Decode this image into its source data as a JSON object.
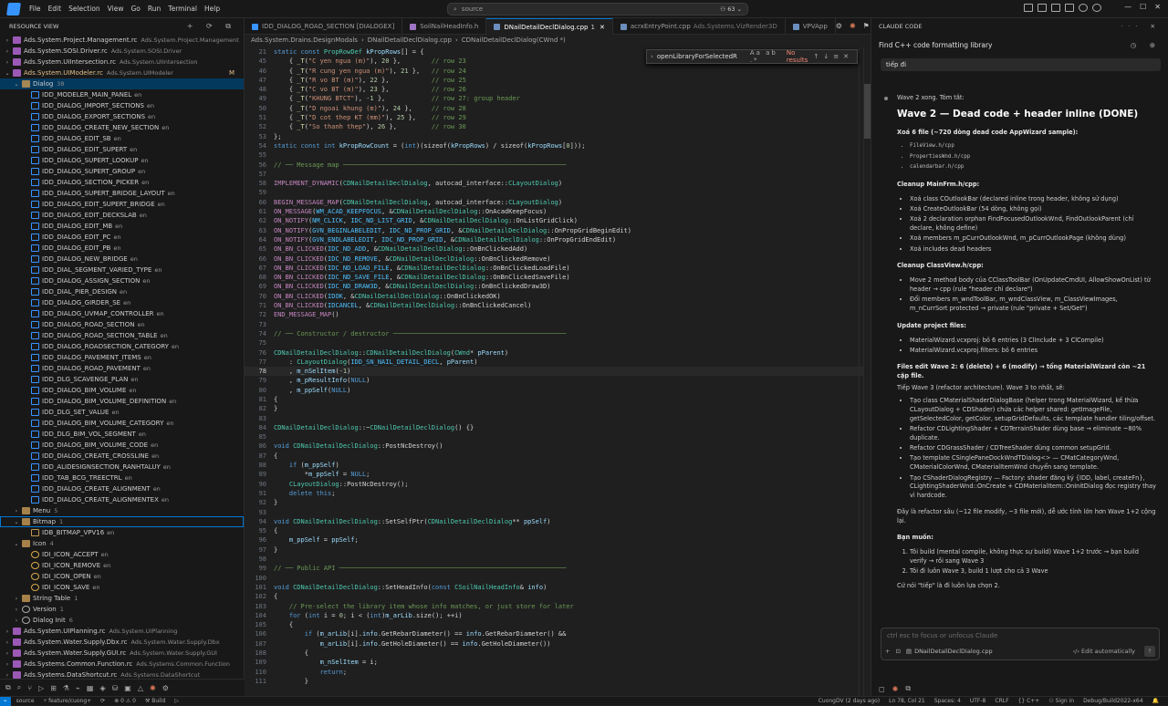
{
  "titlebar": {
    "menu": [
      "File",
      "Edit",
      "Selection",
      "View",
      "Go",
      "Run",
      "Terminal",
      "Help"
    ],
    "search": "source",
    "badge": "63"
  },
  "sidebar": {
    "title": "RESOURCE VIEW",
    "rows": [
      {
        "d": 0,
        "tw": "›",
        "ic": "rc",
        "label": "Ads.System.Project.Management.rc",
        "sub": "Ads.System.Project.Management"
      },
      {
        "d": 0,
        "tw": "›",
        "ic": "rc",
        "label": "Ads.System.SOSI.Driver.rc",
        "sub": "Ads.System.SOSI.Driver"
      },
      {
        "d": 0,
        "tw": "›",
        "ic": "rc",
        "label": "Ads.System.UIIntersection.rc",
        "sub": "Ads.System.UIIntersection"
      },
      {
        "d": 0,
        "tw": "⌄",
        "ic": "rc",
        "label": "Ads.System.UIModeler.rc",
        "sub": "Ads.System.UIModeler",
        "m": "M",
        "mod": true
      },
      {
        "d": 1,
        "tw": "⌄",
        "ic": "folder",
        "label": "Dialog",
        "sub": "38",
        "sel": true
      },
      {
        "d": 2,
        "ic": "dialog",
        "label": "IDD_MODELER_MAIN_PANEL",
        "en": "en"
      },
      {
        "d": 2,
        "ic": "dialog",
        "label": "IDD_DIALOG_IMPORT_SECTIONS",
        "en": "en"
      },
      {
        "d": 2,
        "ic": "dialog",
        "label": "IDD_DIALOG_EXPORT_SECTIONS",
        "en": "en"
      },
      {
        "d": 2,
        "ic": "dialog",
        "label": "IDD_DIALOG_CREATE_NEW_SECTION",
        "en": "en"
      },
      {
        "d": 2,
        "ic": "dialog",
        "label": "IDD_DIALOG_EDIT_SB",
        "en": "en"
      },
      {
        "d": 2,
        "ic": "dialog",
        "label": "IDD_DIALOG_EDIT_SUPERT",
        "en": "en"
      },
      {
        "d": 2,
        "ic": "dialog",
        "label": "IDD_DIALOG_SUPERT_LOOKUP",
        "en": "en"
      },
      {
        "d": 2,
        "ic": "dialog",
        "label": "IDD_DIALOG_SUPERT_GROUP",
        "en": "en"
      },
      {
        "d": 2,
        "ic": "dialog",
        "label": "IDD_DIALOG_SECTION_PICKER",
        "en": "en"
      },
      {
        "d": 2,
        "ic": "dialog",
        "label": "IDD_DIALOG_SUPERT_BRIDGE_LAYOUT",
        "en": "en"
      },
      {
        "d": 2,
        "ic": "dialog",
        "label": "IDD_DIALOG_EDIT_SUPERT_BRIDGE",
        "en": "en"
      },
      {
        "d": 2,
        "ic": "dialog",
        "label": "IDD_DIALOG_EDIT_DECKSLAB",
        "en": "en"
      },
      {
        "d": 2,
        "ic": "dialog",
        "label": "IDD_DIALOG_EDIT_MB",
        "en": "en"
      },
      {
        "d": 2,
        "ic": "dialog",
        "label": "IDD_DIALOG_EDIT_PC",
        "en": "en"
      },
      {
        "d": 2,
        "ic": "dialog",
        "label": "IDD_DIALOG_EDIT_PB",
        "en": "en"
      },
      {
        "d": 2,
        "ic": "dialog",
        "label": "IDD_DIALOG_NEW_BRIDGE",
        "en": "en"
      },
      {
        "d": 2,
        "ic": "dialog",
        "label": "IDD_DIAL_SEGMENT_VARIED_TYPE",
        "en": "en"
      },
      {
        "d": 2,
        "ic": "dialog",
        "label": "IDD_DIALOG_ASSIGN_SECTION",
        "en": "en"
      },
      {
        "d": 2,
        "ic": "dialog",
        "label": "IDD_DIAL_PIER_DESIGN",
        "en": "en"
      },
      {
        "d": 2,
        "ic": "dialog",
        "label": "IDD_DIALOG_GIRDER_SE",
        "en": "en"
      },
      {
        "d": 2,
        "ic": "dialog",
        "label": "IDD_DIALOG_UVMAP_CONTROLLER",
        "en": "en"
      },
      {
        "d": 2,
        "ic": "dialog",
        "label": "IDD_DIALOG_ROAD_SECTION",
        "en": "en"
      },
      {
        "d": 2,
        "ic": "dialog",
        "label": "IDD_DIALOG_ROAD_SECTION_TABLE",
        "en": "en"
      },
      {
        "d": 2,
        "ic": "dialog",
        "label": "IDD_DIALOG_ROADSECTION_CATEGORY",
        "en": "en"
      },
      {
        "d": 2,
        "ic": "dialog",
        "label": "IDD_DIALOG_PAVEMENT_ITEMS",
        "en": "en"
      },
      {
        "d": 2,
        "ic": "dialog",
        "label": "IDD_DIALOG_ROAD_PAVEMENT",
        "en": "en"
      },
      {
        "d": 2,
        "ic": "dialog",
        "label": "IDD_DLG_SCAVENGE_PLAN",
        "en": "en"
      },
      {
        "d": 2,
        "ic": "dialog",
        "label": "IDD_DIALOG_BIM_VOLUME",
        "en": "en"
      },
      {
        "d": 2,
        "ic": "dialog",
        "label": "IDD_DIALOG_BIM_VOLUME_DEFINITION",
        "en": "en"
      },
      {
        "d": 2,
        "ic": "dialog",
        "label": "IDD_DLG_SET_VALUE",
        "en": "en"
      },
      {
        "d": 2,
        "ic": "dialog",
        "label": "IDD_DIALOG_BIM_VOLUME_CATEGORY",
        "en": "en"
      },
      {
        "d": 2,
        "ic": "dialog",
        "label": "IDD_DLG_BIM_VOL_SEGMENT",
        "en": "en"
      },
      {
        "d": 2,
        "ic": "dialog",
        "label": "IDD_DIALOG_BIM_VOLUME_CODE",
        "en": "en"
      },
      {
        "d": 2,
        "ic": "dialog",
        "label": "IDD_DIALOG_CREATE_CROSSLINE",
        "en": "en"
      },
      {
        "d": 2,
        "ic": "dialog",
        "label": "IDD_ALIDESIGNSECTION_RANHTALUY",
        "en": "en"
      },
      {
        "d": 2,
        "ic": "dialog",
        "label": "IDD_TAB_BCG_TREECTRL",
        "en": "en"
      },
      {
        "d": 2,
        "ic": "dialog",
        "label": "IDD_DIALOG_CREATE_ALIGNMENT",
        "en": "en"
      },
      {
        "d": 2,
        "ic": "dialog",
        "label": "IDD_DIALOG_CREATE_ALIGNMENTEX",
        "en": "en"
      },
      {
        "d": 1,
        "tw": "›",
        "ic": "folder",
        "label": "Menu",
        "sub": "5"
      },
      {
        "d": 1,
        "tw": "⌄",
        "ic": "folder",
        "label": "Bitmap",
        "sub": "1",
        "hl": true
      },
      {
        "d": 2,
        "ic": "bitmap",
        "label": "IDB_BITMAP_VPV16",
        "en": "en"
      },
      {
        "d": 1,
        "tw": "⌄",
        "ic": "folder",
        "label": "Icon",
        "sub": "4"
      },
      {
        "d": 2,
        "ic": "icon",
        "label": "IDI_ICON_ACCEPT",
        "en": "en"
      },
      {
        "d": 2,
        "ic": "icon",
        "label": "IDI_ICON_REMOVE",
        "en": "en"
      },
      {
        "d": 2,
        "ic": "icon",
        "label": "IDI_ICON_OPEN",
        "en": "en"
      },
      {
        "d": 2,
        "ic": "icon",
        "label": "IDI_ICON_SAVE",
        "en": "en"
      },
      {
        "d": 1,
        "tw": "›",
        "ic": "folder",
        "label": "String Table",
        "sub": "1"
      },
      {
        "d": 1,
        "tw": "›",
        "ic": "gear",
        "label": "Version",
        "sub": "1"
      },
      {
        "d": 1,
        "tw": "›",
        "ic": "gear",
        "label": "Dialog Init",
        "sub": "6"
      },
      {
        "d": 0,
        "tw": "›",
        "ic": "rc",
        "label": "Ads.System.UIPlanning.rc",
        "sub": "Ads.System.UIPlanning"
      },
      {
        "d": 0,
        "tw": "›",
        "ic": "rc",
        "label": "Ads.System.Water.Supply.Dbx.rc",
        "sub": "Ads.System.Water.Supply.Dbx"
      },
      {
        "d": 0,
        "tw": "›",
        "ic": "rc",
        "label": "Ads.System.Water.Supply.GUI.rc",
        "sub": "Ads.System.Water.Supply.GUI"
      },
      {
        "d": 0,
        "tw": "›",
        "ic": "rc",
        "label": "Ads.Systems.Common.Function.rc",
        "sub": "Ads.Systems.Common.Function"
      },
      {
        "d": 0,
        "tw": "›",
        "ic": "rc",
        "label": "Ads.Systems.DataShortcut.rc",
        "sub": "Ads.Systems.DataShortcut"
      }
    ]
  },
  "tabs": [
    {
      "label": "IDD_DIALOG_ROAD_SECTION [DIALOGEX]",
      "ic": "#3794ff",
      "desc": ""
    },
    {
      "label": "SoilNailHeadInfo.h",
      "ic": "#a074c4",
      "desc": ""
    },
    {
      "label": "DNailDetailDeclDialog.cpp",
      "ic": "#6c8ebf",
      "desc": "1",
      "active": true
    },
    {
      "label": "acrxEntryPoint.cpp",
      "ic": "#6c8ebf",
      "desc": "Ads.Systems.VizRender3D"
    },
    {
      "label": "VPVApp",
      "ic": "#6c8ebf",
      "desc": ""
    }
  ],
  "breadcrumb": [
    "Ads.System.Drains.DesignModals",
    "DNailDetailDeclDialog.cpp",
    "CDNailDetailDeclDialog(CWnd *)"
  ],
  "find": {
    "query": "openLibraryForSelectedR",
    "opts": "Aa ab .*",
    "result": "No results"
  },
  "code": [
    {
      "n": "21",
      "t": "static const PropRowDef kPropRows[] = {"
    },
    {
      "n": "45",
      "t": "    { _T(\"C yen ngua (m)\"), 20 },        // row 23"
    },
    {
      "n": "46",
      "t": "    { _T(\"R cung yen ngua (m)\"), 21 },   // row 24"
    },
    {
      "n": "47",
      "t": "    { _T(\"R vo BT (m)\"), 22 },           // row 25"
    },
    {
      "n": "48",
      "t": "    { _T(\"C vo BT (m)\"), 23 },           // row 26"
    },
    {
      "n": "49",
      "t": "    { _T(\"KHUNG BTCT\"), -1 },            // row 27: group header"
    },
    {
      "n": "50",
      "t": "    { _T(\"D ngoai khung (m)\"), 24 },     // row 28"
    },
    {
      "n": "51",
      "t": "    { _T(\"D cot thep KT (mm)\"), 25 },    // row 29"
    },
    {
      "n": "52",
      "t": "    { _T(\"So thanh thep\"), 26 },         // row 30"
    },
    {
      "n": "53",
      "t": "};"
    },
    {
      "n": "54",
      "t": "static const int kPropRowCount = (int)(sizeof(kPropRows) / sizeof(kPropRows[0]));"
    },
    {
      "n": "55",
      "t": ""
    },
    {
      "n": "56",
      "t": "// ── Message map ──────────────────────────────────────────────────────────"
    },
    {
      "n": "57",
      "t": ""
    },
    {
      "n": "58",
      "t": "IMPLEMENT_DYNAMIC(CDNailDetailDeclDialog, autocad_interface::CLayoutDialog)"
    },
    {
      "n": "59",
      "t": ""
    },
    {
      "n": "60",
      "t": "BEGIN_MESSAGE_MAP(CDNailDetailDeclDialog, autocad_interface::CLayoutDialog)"
    },
    {
      "n": "61",
      "t": "ON_MESSAGE(WM_ACAD_KEEPFOCUS, &CDNailDetailDeclDialog::OnAcadKeepFocus)"
    },
    {
      "n": "62",
      "t": "ON_NOTIFY(NM_CLICK, IDC_ND_LIST_GRID, &CDNailDetailDeclDialog::OnListGridClick)"
    },
    {
      "n": "63",
      "t": "ON_NOTIFY(GVN_BEGINLABELEDIT, IDC_ND_PROP_GRID, &CDNailDetailDeclDialog::OnPropGridBeginEdit)"
    },
    {
      "n": "64",
      "t": "ON_NOTIFY(GVN_ENDLABELEDIT, IDC_ND_PROP_GRID, &CDNailDetailDeclDialog::OnPropGridEndEdit)"
    },
    {
      "n": "65",
      "t": "ON_BN_CLICKED(IDC_ND_ADD, &CDNailDetailDeclDialog::OnBnClickedAdd)"
    },
    {
      "n": "66",
      "t": "ON_BN_CLICKED(IDC_ND_REMOVE, &CDNailDetailDeclDialog::OnBnClickedRemove)"
    },
    {
      "n": "67",
      "t": "ON_BN_CLICKED(IDC_ND_LOAD_FILE, &CDNailDetailDeclDialog::OnBnClickedLoadFile)"
    },
    {
      "n": "68",
      "t": "ON_BN_CLICKED(IDC_ND_SAVE_FILE, &CDNailDetailDeclDialog::OnBnClickedSaveFile)"
    },
    {
      "n": "69",
      "t": "ON_BN_CLICKED(IDC_ND_DRAW3D, &CDNailDetailDeclDialog::OnBnClickedDraw3D)"
    },
    {
      "n": "70",
      "t": "ON_BN_CLICKED(IDOK, &CDNailDetailDeclDialog::OnBnClickedOK)"
    },
    {
      "n": "71",
      "t": "ON_BN_CLICKED(IDCANCEL, &CDNailDetailDeclDialog::OnBnClickedCancel)"
    },
    {
      "n": "72",
      "t": "END_MESSAGE_MAP()"
    },
    {
      "n": "73",
      "t": ""
    },
    {
      "n": "74",
      "t": "// ── Constructor / destructor ─────────────────────────────────────────────"
    },
    {
      "n": "75",
      "t": ""
    },
    {
      "n": "76",
      "t": "CDNailDetailDeclDialog::CDNailDetailDeclDialog(CWnd* pParent)"
    },
    {
      "n": "77",
      "t": "    : CLayoutDialog(IDD_SN_NAIL_DETAIL_DECL, pParent)"
    },
    {
      "n": "78",
      "t": "    , m_nSelItem(-1)",
      "cur": true
    },
    {
      "n": "79",
      "t": "    , m_pResultInfo(NULL)"
    },
    {
      "n": "80",
      "t": "    , m_ppSelf(NULL)"
    },
    {
      "n": "81",
      "t": "{"
    },
    {
      "n": "82",
      "t": "}"
    },
    {
      "n": "83",
      "t": ""
    },
    {
      "n": "84",
      "t": "CDNailDetailDeclDialog::~CDNailDetailDeclDialog() {}"
    },
    {
      "n": "85",
      "t": ""
    },
    {
      "n": "86",
      "t": "void CDNailDetailDeclDialog::PostNcDestroy()"
    },
    {
      "n": "87",
      "t": "{"
    },
    {
      "n": "88",
      "t": "    if (m_ppSelf)"
    },
    {
      "n": "89",
      "t": "        *m_ppSelf = NULL;"
    },
    {
      "n": "90",
      "t": "    CLayoutDialog::PostNcDestroy();"
    },
    {
      "n": "91",
      "t": "    delete this;"
    },
    {
      "n": "92",
      "t": "}"
    },
    {
      "n": "93",
      "t": ""
    },
    {
      "n": "94",
      "t": "void CDNailDetailDeclDialog::SetSelfPtr(CDNailDetailDeclDialog** ppSelf)"
    },
    {
      "n": "95",
      "t": "{"
    },
    {
      "n": "96",
      "t": "    m_ppSelf = ppSelf;"
    },
    {
      "n": "97",
      "t": "}"
    },
    {
      "n": "98",
      "t": ""
    },
    {
      "n": "99",
      "t": "// ── Public API ───────────────────────────────────────────────────────────"
    },
    {
      "n": "100",
      "t": ""
    },
    {
      "n": "101",
      "t": "void CDNailDetailDeclDialog::SetHeadInfo(const CSoilNailHeadInfo& info)"
    },
    {
      "n": "102",
      "t": "{"
    },
    {
      "n": "103",
      "t": "    // Pre-select the library item whose info matches, or just store for later"
    },
    {
      "n": "104",
      "t": "    for (int i = 0; i < (int)m_arLib.size(); ++i)"
    },
    {
      "n": "105",
      "t": "    {"
    },
    {
      "n": "106",
      "t": "        if (m_arLib[i].info.GetRebarDiameter() == info.GetRebarDiameter() &&"
    },
    {
      "n": "107",
      "t": "            m_arLib[i].info.GetHoleDiameter() == info.GetHoleDiameter())"
    },
    {
      "n": "108",
      "t": "        {"
    },
    {
      "n": "109",
      "t": "            m_nSelItem = i;"
    },
    {
      "n": "110",
      "t": "            return;"
    },
    {
      "n": "111",
      "t": "        }"
    }
  ],
  "panel": {
    "header": "CLAUDE CODE",
    "conv_title": "Find C++ code formatting library",
    "user_msg": "tiếp đi",
    "status_line": "Wave 2 xong. Tóm tắt:",
    "heading": "Wave 2 — Dead code + header inline (DONE)",
    "s1_title": "Xoá 6 file (~720 dòng dead code AppWizard sample):",
    "s1_items": [
      "FileView.h/cpp",
      "PropertiesWnd.h/cpp",
      "calendarbar.h/cpp"
    ],
    "s2_title": "Cleanup MainFrm.h/cpp:",
    "s2_items": [
      "Xoá class COutlookBar (declared inline trong header, không sử dụng)",
      "Xoá CreateOutlookBar (54 dòng, không gọi)",
      "Xoá 2 declaration orphan FindFocusedOutlookWnd, FindOutlookParent (chỉ declare, không define)",
      "Xoá members m_pCurrOutlookWnd, m_pCurrOutlookPage (không dùng)",
      "Xoá includes dead headers"
    ],
    "s3_title": "Cleanup ClassView.h/cpp:",
    "s3_items": [
      "Move 2 method body của CClassToolBar (OnUpdateCmdUI, AllowShowOnList) từ header → cpp (rule \"header chỉ declare\")",
      "Đổi members m_wndToolBar, m_wndClassView, m_ClassViewImages, m_nCurrSort protected → private (rule \"private + Set/Get\")"
    ],
    "s4_title": "Update project files:",
    "s4_items": [
      "MaterialWizard.vcxproj: bỏ 6 entries (3 ClInclude + 3 ClCompile)",
      "MaterialWizard.vcxproj.filters: bỏ 6 entries"
    ],
    "s5_text": "Files edit Wave 2: 6 (delete) + 6 (modify) → tổng MaterialWizard còn ~21 cặp file.",
    "s5_text2": "Tiếp Wave 3 (refactor architecture). Wave 3 to nhất, sẽ:",
    "s5_items": [
      "Tạo class CMaterialShaderDialogBase (helper trong MaterialWizard, kế thừa CLayoutDialog + CDShader) chứa các helper shared: getImageFile, getSelectedColor, getColor, setupGridDefaults, các template handler tiling/offset.",
      "Refactor CDLightingShader + CDTerrainShader dùng base → eliminate ~80% duplicate.",
      "Refactor CDGrassShader / CDTreeShader dùng common setupGrid.",
      "Tạo template CSinglePaneDockWndTDialog<> — CMatCategoryWnd, CMaterialColorWnd, CMaterialItemWnd chuyển sang template.",
      "Tạo CShaderDialogRegistry — Factory: shader đăng ký {IDD, label, createFn}, CLightingShaderWnd::OnCreate + CDMaterialItem::OnInitDialog đọc registry thay vì hardcode."
    ],
    "s6_text": "Đây là refactor sâu (~12 file modify, ~3 file mới), dễ ước tính lớn hơn Wave 1+2 cộng lại.",
    "s6_title": "Bạn muốn:",
    "s6_items": [
      "Tôi build (mental compile, không thực sự build) Wave 1+2 trước → bạn build verify → rồi sang Wave 3",
      "Tôi đi luôn Wave 3, build 1 lượt cho cả 3 Wave"
    ],
    "s7_text": "Cứ nói \"tiếp\" là đi luôn lựa chọn 2.",
    "placeholder": "ctrl esc to focus or unfocus Claude",
    "attached_file": "DNailDetailDeclDialog.cpp",
    "mode": "Edit automatically"
  },
  "status": {
    "left": [
      "⌁",
      "source",
      "⑂ feature/cuong+",
      "⟳",
      "⊗ 0 ⚠ 0",
      "⚒ Build",
      "▷"
    ],
    "right": [
      "CuongDV (2 days ago)",
      "Ln 78, Col 21",
      "Spaces: 4",
      "UTF-8",
      "CRLF",
      "{} C++",
      "⚇ Sign in",
      "Debug/Build2022-x64",
      "🔔"
    ]
  }
}
